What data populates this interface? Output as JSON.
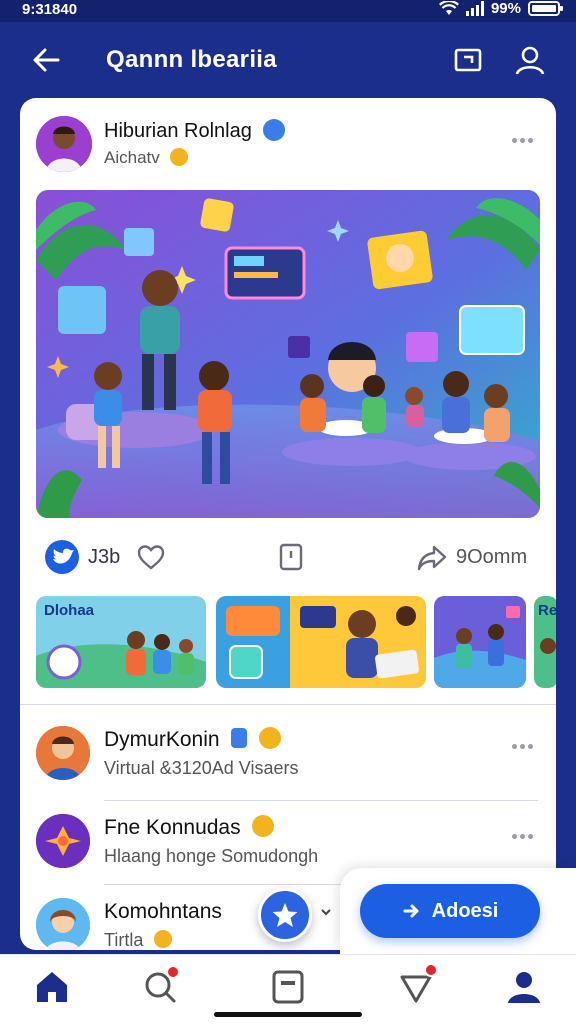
{
  "status_bar": {
    "time": "9:31840",
    "battery": "99%"
  },
  "header": {
    "title": "Qannn lbeariia"
  },
  "post": {
    "author": "Hiburian Rolnlag",
    "subtitle": "Aichatv",
    "like_count": "J3b",
    "share_label": "9Oomm"
  },
  "thumbnails": [
    {
      "caption": "Dlohaa"
    },
    {
      "caption": ""
    },
    {
      "caption": ""
    },
    {
      "caption": "Re"
    }
  ],
  "list": [
    {
      "name": "DymurKonin",
      "desc": "Virtual &3120Ad Visaers"
    },
    {
      "name": "Fne Konnudas",
      "desc": "Hlaang honge Somudongh"
    },
    {
      "name": "Komohntans",
      "desc": "Tirtla"
    }
  ],
  "fab": {
    "label": "Adoesi"
  },
  "colors": {
    "brand": "#1c2e8c",
    "accent": "#1d5fe3",
    "notify": "#e3262e",
    "badge_gold": "#f2b31e"
  }
}
